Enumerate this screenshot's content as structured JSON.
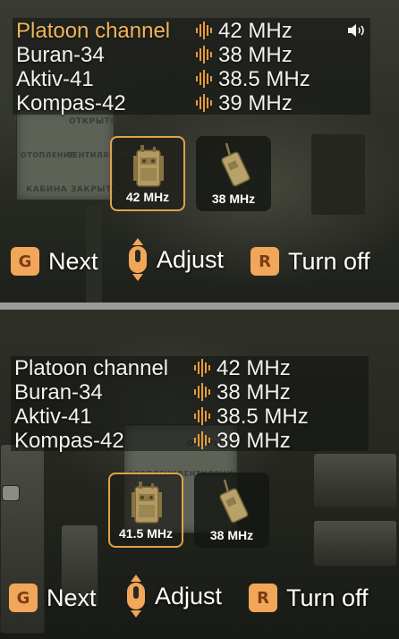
{
  "panels": [
    {
      "channels": [
        {
          "name": "Platoon channel",
          "freq": "42 MHz",
          "active": true
        },
        {
          "name": "Buran-34",
          "freq": "38 MHz",
          "active": false
        },
        {
          "name": "Aktiv-41",
          "freq": "38.5 MHz",
          "active": false
        },
        {
          "name": "Kompas-42",
          "freq": "39 MHz",
          "active": false
        }
      ],
      "speaker_icon": "speaker-icon",
      "devices": [
        {
          "label": "42 MHz",
          "icon": "radio-backpack-icon",
          "selected": true
        },
        {
          "label": "38 MHz",
          "icon": "handheld-radio-icon",
          "selected": false
        }
      ],
      "actions": {
        "next": {
          "key": "G",
          "label": "Next"
        },
        "adjust": {
          "icon": "mouse-wheel-icon",
          "label": "Adjust"
        },
        "turn_off": {
          "key": "R",
          "label": "Turn off"
        }
      }
    },
    {
      "channels": [
        {
          "name": "Platoon channel",
          "freq": "42 MHz",
          "active": false
        },
        {
          "name": "Buran-34",
          "freq": "38 MHz",
          "active": false
        },
        {
          "name": "Aktiv-41",
          "freq": "38.5 MHz",
          "active": false
        },
        {
          "name": "Kompas-42",
          "freq": "39 MHz",
          "active": false
        }
      ],
      "devices": [
        {
          "label": "41.5 MHz",
          "icon": "radio-backpack-icon",
          "selected": true
        },
        {
          "label": "38 MHz",
          "icon": "handheld-radio-icon",
          "selected": false
        }
      ],
      "actions": {
        "next": {
          "key": "G",
          "label": "Next"
        },
        "adjust": {
          "icon": "mouse-wheel-icon",
          "label": "Adjust"
        },
        "turn_off": {
          "key": "R",
          "label": "Turn off"
        }
      }
    }
  ],
  "background_plate": {
    "text": [
      "ОТКРЫТО",
      "ОТОПЛЕНИЕ",
      "ВЕНТИЛЯЦИЯ",
      "КАБИНА",
      "ЗАКРЫТО"
    ]
  },
  "colors": {
    "accent": "#f0b65a",
    "key_bg": "#f2a65a",
    "text": "#f2f2ee"
  }
}
